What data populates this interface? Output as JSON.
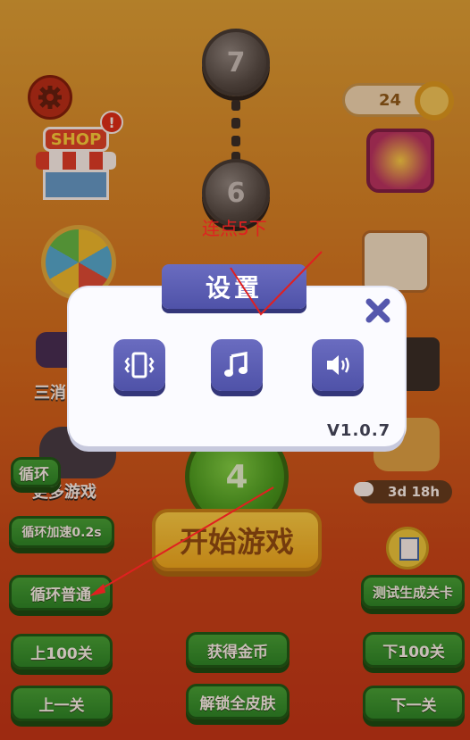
{
  "hud": {
    "coin_count": "24",
    "shop_label": "SHOP",
    "alert_mark": "!"
  },
  "level_path": {
    "levels": [
      "7",
      "6",
      "4"
    ]
  },
  "side_menu": {
    "left_third_label": "三消",
    "more_games_label": "更多游戏",
    "event_timer": "3d 18h"
  },
  "start_button_label": "开始游戏",
  "debug_buttons": {
    "row1_left": "循环",
    "loop_speed": "循环加速0.2s",
    "loop_normal": "循环普通",
    "test_level": "测试生成关卡",
    "up_100": "上100关",
    "get_coins": "获得金币",
    "down_100": "下100关",
    "prev_level": "上一关",
    "unlock_skins": "解锁全皮肤",
    "next_level": "下一关"
  },
  "settings_dialog": {
    "title": "设置",
    "version": "V1.0.7",
    "options": [
      "vibration-icon",
      "music-icon",
      "sound-icon"
    ],
    "accent_color": "#5557ad"
  },
  "annotation": {
    "label": "连点5下",
    "color": "#e02020"
  }
}
